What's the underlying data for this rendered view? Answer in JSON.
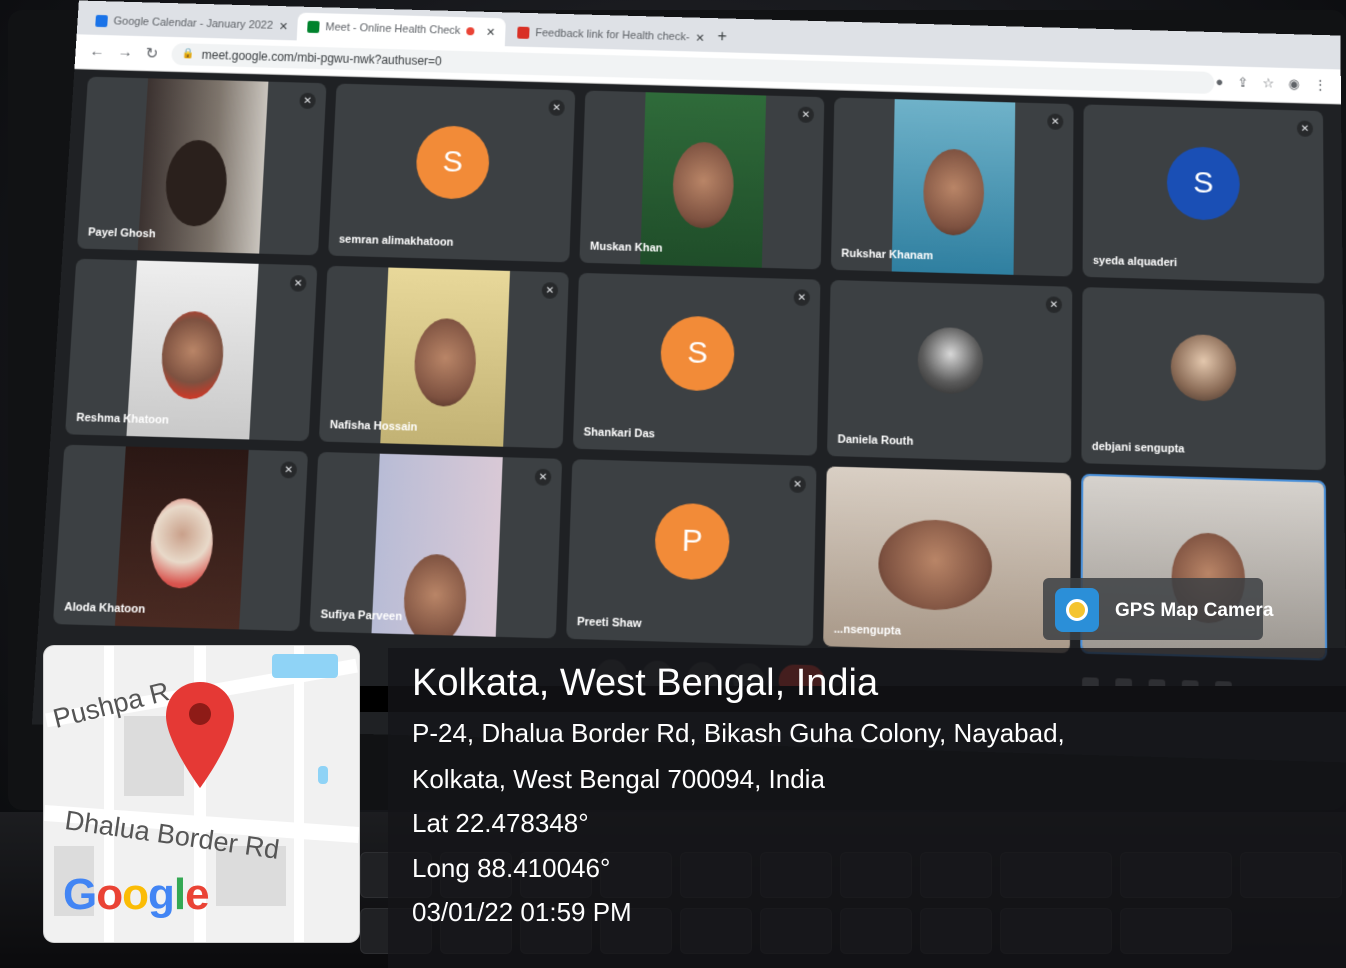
{
  "browser": {
    "tabs": [
      {
        "title": "Google Calendar - January 2022",
        "icon": "calendar-icon",
        "color": "#1a73e8"
      },
      {
        "title": "Meet - Online Health Check",
        "icon": "meet-icon",
        "color": "#00832d"
      },
      {
        "title": "Feedback link for Health check-",
        "icon": "gmail-icon",
        "color": "#d93025"
      }
    ],
    "url": "meet.google.com/mbi-pgwu-nwk?authuser=0"
  },
  "participants": [
    {
      "name": "Payel Ghosh",
      "kind": "video"
    },
    {
      "name": "semran alimakhatoon",
      "kind": "avatar",
      "initial": "S",
      "color": "#f28b38"
    },
    {
      "name": "Muskan Khan",
      "kind": "video"
    },
    {
      "name": "Rukshar Khanam",
      "kind": "video"
    },
    {
      "name": "syeda alquaderi",
      "kind": "avatar",
      "initial": "S",
      "color": "#1a4fb5"
    },
    {
      "name": "Reshma Khatoon",
      "kind": "video"
    },
    {
      "name": "Nafisha Hossain",
      "kind": "video"
    },
    {
      "name": "Shankari Das",
      "kind": "avatar",
      "initial": "S",
      "color": "#f28b38"
    },
    {
      "name": "Daniela Routh",
      "kind": "photo"
    },
    {
      "name": "debjani sengupta",
      "kind": "photo"
    },
    {
      "name": "Aloda Khatoon",
      "kind": "video"
    },
    {
      "name": "Sufiya Parveen",
      "kind": "video"
    },
    {
      "name": "Preeti Shaw",
      "kind": "avatar",
      "initial": "P",
      "color": "#f28b38"
    },
    {
      "name": "...nsengupta",
      "kind": "video"
    },
    {
      "name": "",
      "kind": "video"
    }
  ],
  "gps": {
    "app_name": "GPS Map Camera",
    "location_title": "Kolkata, West Bengal, India",
    "address_line1": "P-24, Dhalua Border Rd, Bikash Guha Colony, Nayabad,",
    "address_line2": "Kolkata, West Bengal 700094, India",
    "lat": "Lat 22.478348°",
    "long": "Long 88.410046°",
    "datetime": "03/01/22 01:59 PM"
  },
  "map": {
    "road_label_1": "Pushpa R",
    "road_label_2": "Dhalua Border Rd",
    "logo": [
      "G",
      "o",
      "o",
      "g",
      "l",
      "e"
    ],
    "logo_colors": [
      "#4285f4",
      "#ea4335",
      "#fbbc05",
      "#4285f4",
      "#34a853",
      "#ea4335"
    ]
  }
}
